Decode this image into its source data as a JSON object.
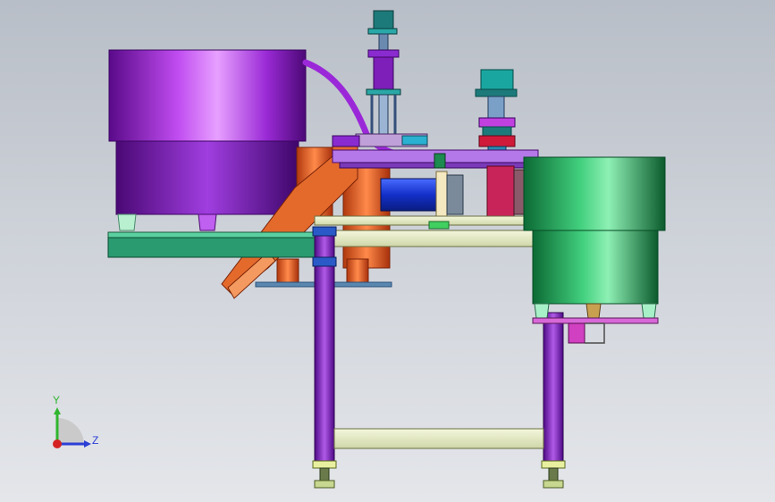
{
  "viewport": {
    "background_top": "#b8bec7",
    "background_bottom": "#e4e6ea"
  },
  "triad": {
    "y_label": "Y",
    "z_label": "Z",
    "y_color": "#2fb52f",
    "z_color": "#2b3fd6",
    "x_color": "#d42222"
  },
  "model": {
    "left_bowl_color": "#8c1cc4",
    "right_bowl_color": "#1fa45a",
    "frame_leg_color": "#8a2bd0",
    "chute_color": "#e0602a",
    "motor_color": "#1f3fd8",
    "table_color": "#2a9a70"
  }
}
